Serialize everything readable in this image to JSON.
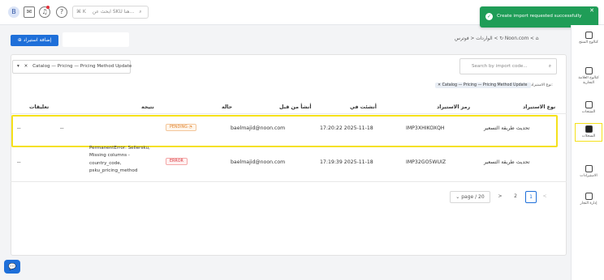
{
  "topbar": {
    "avatar": "B",
    "search_placeholder": "ابحث عن SKU هنا...",
    "search_shortcut": "⌘ K"
  },
  "toast": {
    "text": "Create import requested successfully"
  },
  "actions": {
    "add_import": "إضافة استيراد"
  },
  "breadcrumb": {
    "home": "⌂",
    "store": "Noon.com",
    "section": "فوترس",
    "page": "الواردات"
  },
  "filters": {
    "catalog_filter": "Catalog — Pricing — Pricing Method Update",
    "search_placeholder": "Search by import code...",
    "chip_label": "نوع الاستيراد:",
    "chip_value": "Catalog — Pricing — Pricing Method Update"
  },
  "table": {
    "headers": [
      "نوع الاستيراد",
      "رمز الاستيراد",
      "أنشئت في",
      "أنشأ من قبل",
      "حالة",
      "نتيجة",
      "تعليقات"
    ],
    "rows": [
      {
        "type": "تحديث طريقة التسعير",
        "code": "IMP3XHIKOXQH",
        "created": "17:20:22 2025-11-18",
        "by": "baelmajid@noon.com",
        "status": "PENDING",
        "result": "--",
        "comments": "--"
      },
      {
        "type": "تحديث طريقة التسعير",
        "code": "IMP32GO5WUIZ",
        "created": "17:19:39 2025-11-18",
        "by": "baelmajid@noon.com",
        "status": "ERROR",
        "result": "PermanentError: Sellersku, Missing columns - country_code, psku_pricing_method",
        "comments": "--"
      }
    ]
  },
  "pagination": {
    "page_select": "page / 20",
    "pages": [
      "2",
      "1"
    ],
    "next": ">",
    "prev": "<"
  },
  "sidebar": {
    "items": [
      "كتالوج المنتج",
      "كتالوج العلامة التجارية",
      "المنتجات",
      "السجلات",
      "الاستيرادات",
      "إدارة التجار"
    ]
  },
  "colors": {
    "primary": "#1e6fd9",
    "highlight": "#f5e11b",
    "toast": "#1f9d57",
    "pending": "#e0832d",
    "error": "#d9363e"
  }
}
